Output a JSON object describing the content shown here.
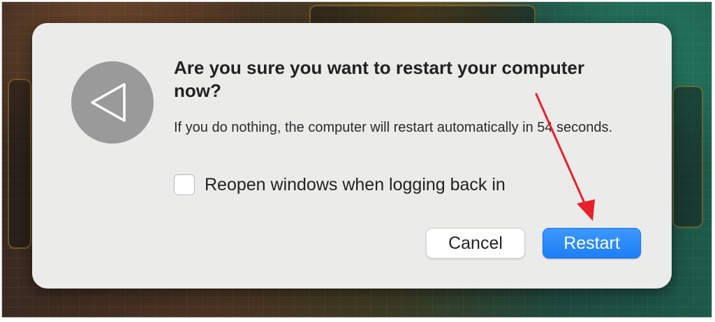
{
  "dialog": {
    "title": "Are you sure you want to restart your computer now?",
    "message": "If you do nothing, the computer will restart automatically in 54 seconds.",
    "checkbox": {
      "label": "Reopen windows when logging back in",
      "checked": false
    },
    "buttons": {
      "cancel_label": "Cancel",
      "restart_label": "Restart"
    },
    "icon": "restart-triangle-icon"
  },
  "annotation": {
    "type": "arrow",
    "color": "#e8202a",
    "points_to": "restart-button"
  },
  "colors": {
    "dialog_background": "#ebebea",
    "primary_button": "#1d7ff5",
    "icon_background": "#9a9a9a"
  }
}
